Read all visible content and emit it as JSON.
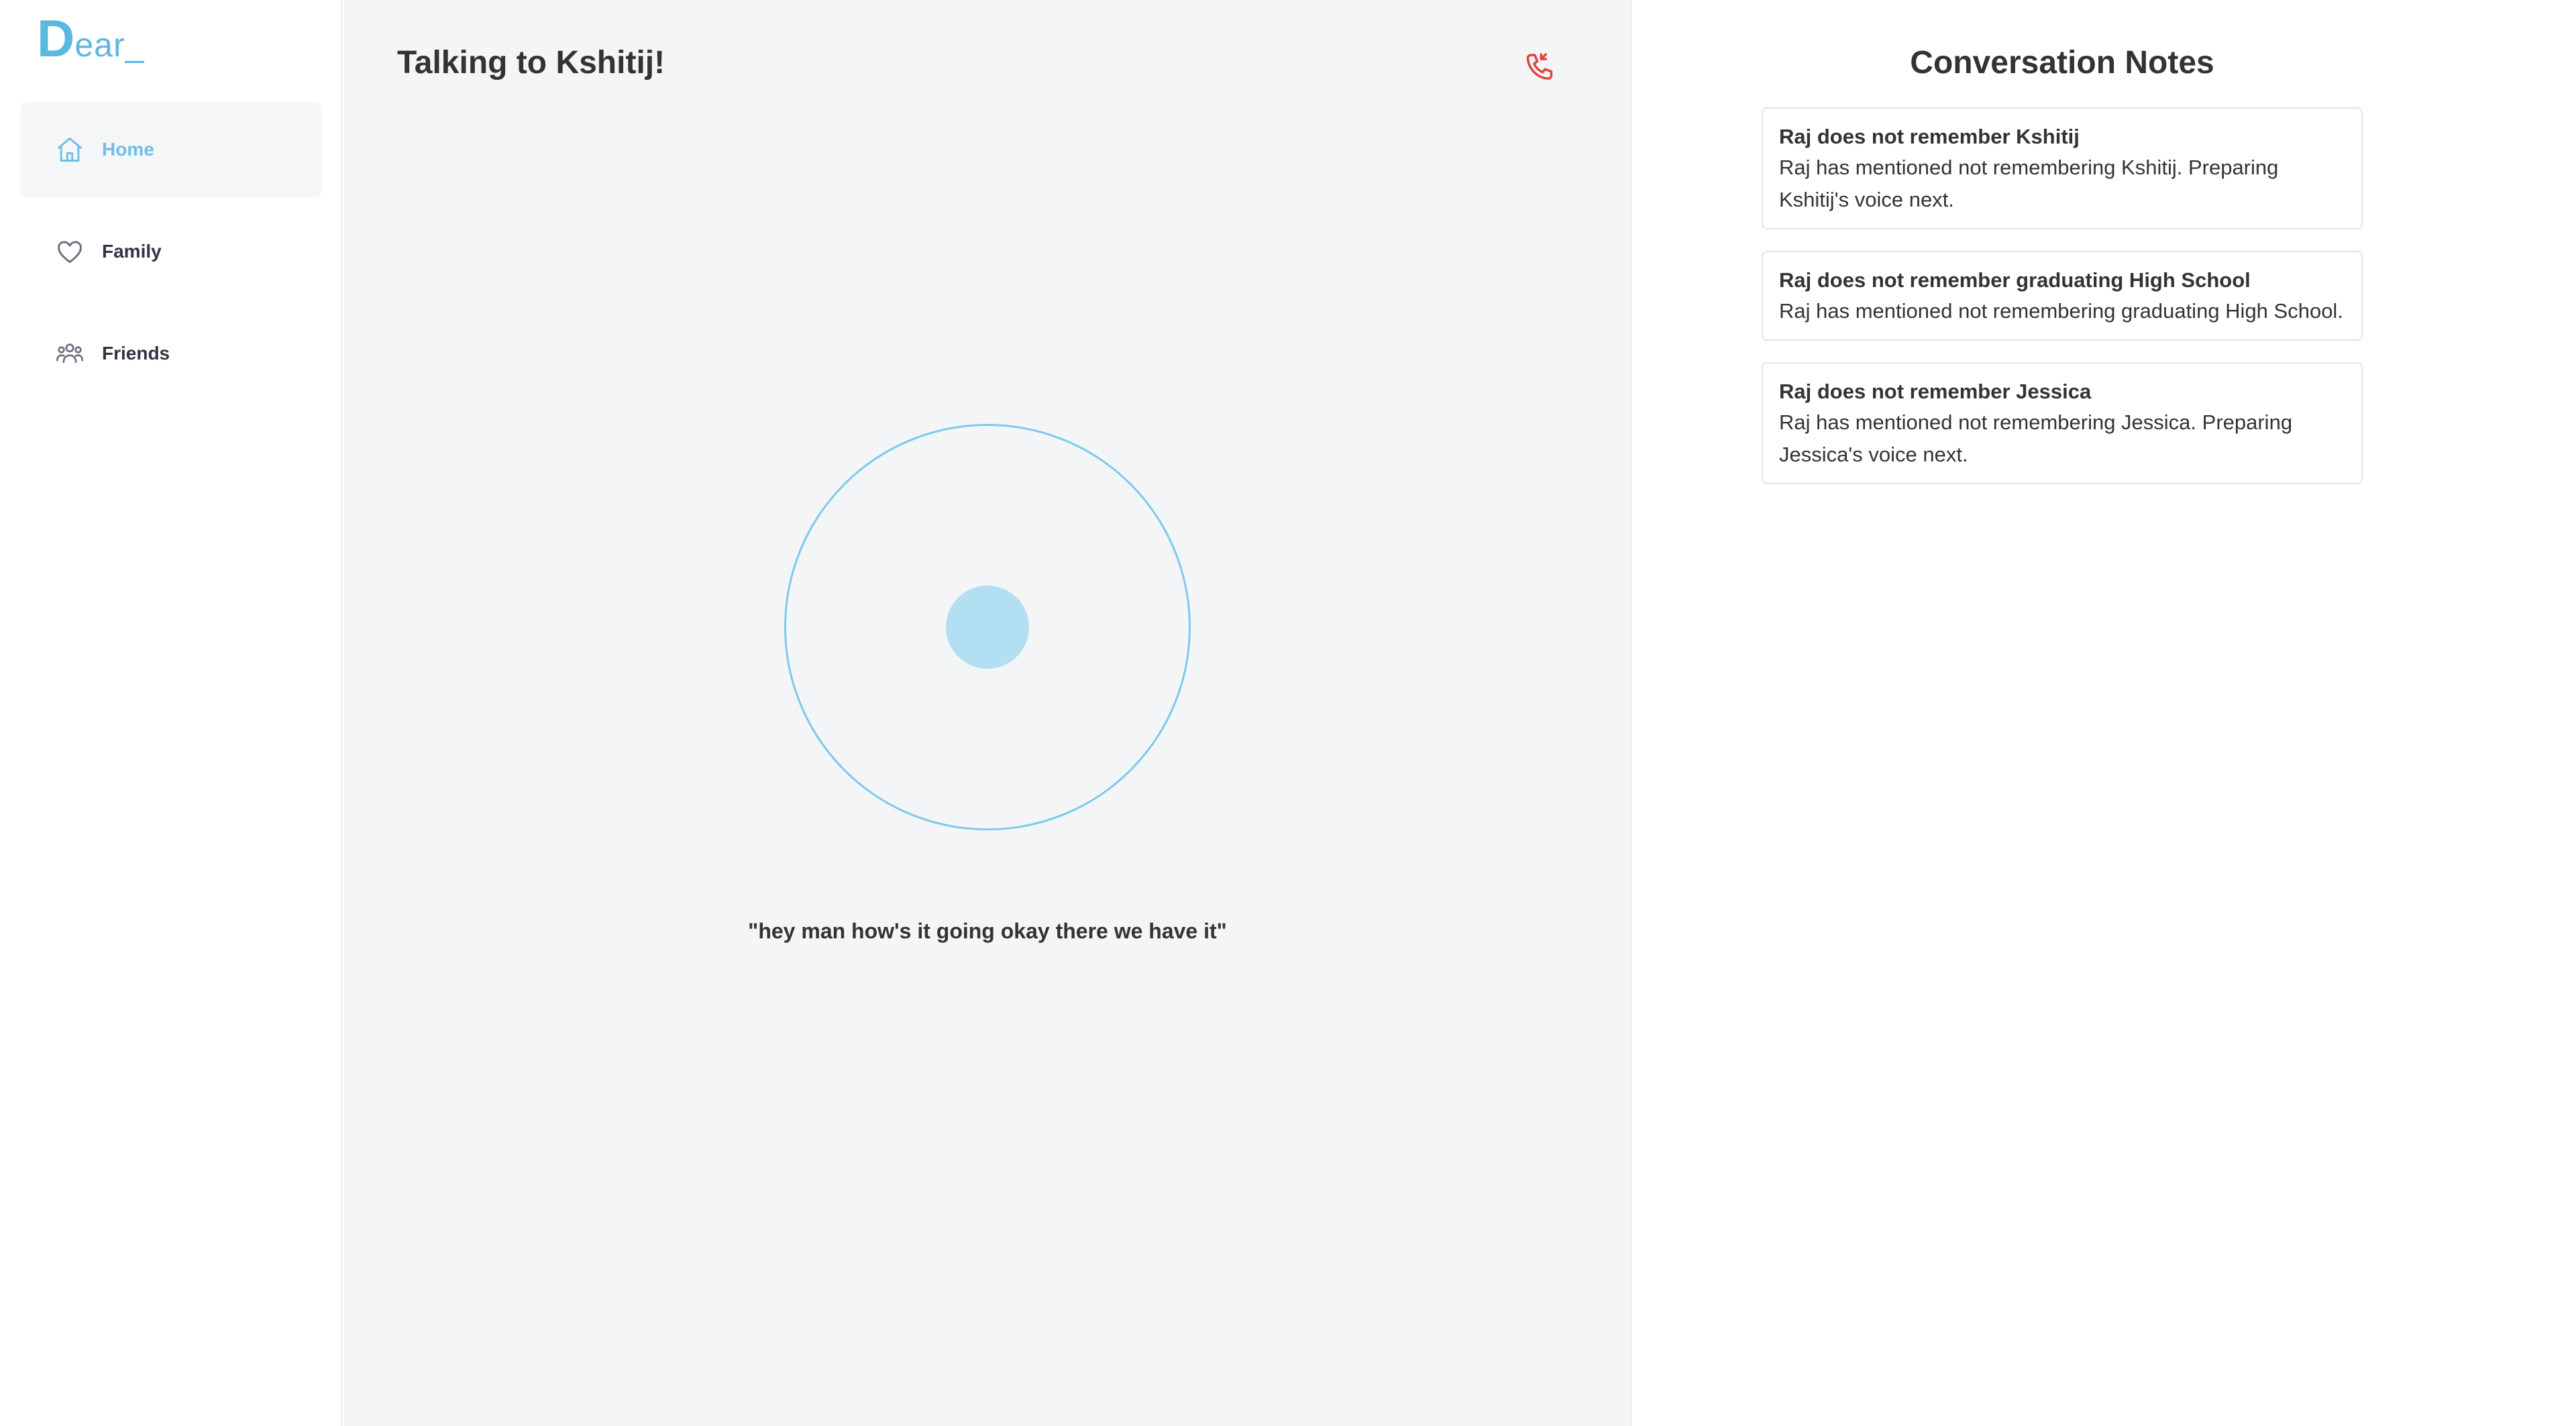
{
  "brand": {
    "logo_big": "D",
    "logo_rest": "ear_"
  },
  "sidebar": {
    "items": [
      {
        "label": "Home",
        "icon": "home-icon",
        "active": true
      },
      {
        "label": "Family",
        "icon": "heart-icon",
        "active": false
      },
      {
        "label": "Friends",
        "icon": "users-icon",
        "active": false
      }
    ]
  },
  "main": {
    "title": "Talking to Kshitij!",
    "hangup_icon": "phone-incoming-icon",
    "transcript": "\"hey man how's it going okay there we have it\""
  },
  "notes": {
    "title": "Conversation Notes",
    "items": [
      {
        "title": "Raj does not remember Kshitij",
        "body": "Raj has mentioned not remembering Kshitij. Preparing Kshitij's voice next."
      },
      {
        "title": "Raj does not remember graduating High School",
        "body": "Raj has mentioned not remembering graduating High School."
      },
      {
        "title": "Raj does not remember Jessica",
        "body": "Raj has mentioned not remembering Jessica. Preparing Jessica's voice next."
      }
    ]
  },
  "colors": {
    "accent": "#6fbfe4",
    "ring": "#7ccbea",
    "orb": "#b2dff1",
    "hangup": "#e0453a",
    "main_bg": "#f4f5f7"
  }
}
